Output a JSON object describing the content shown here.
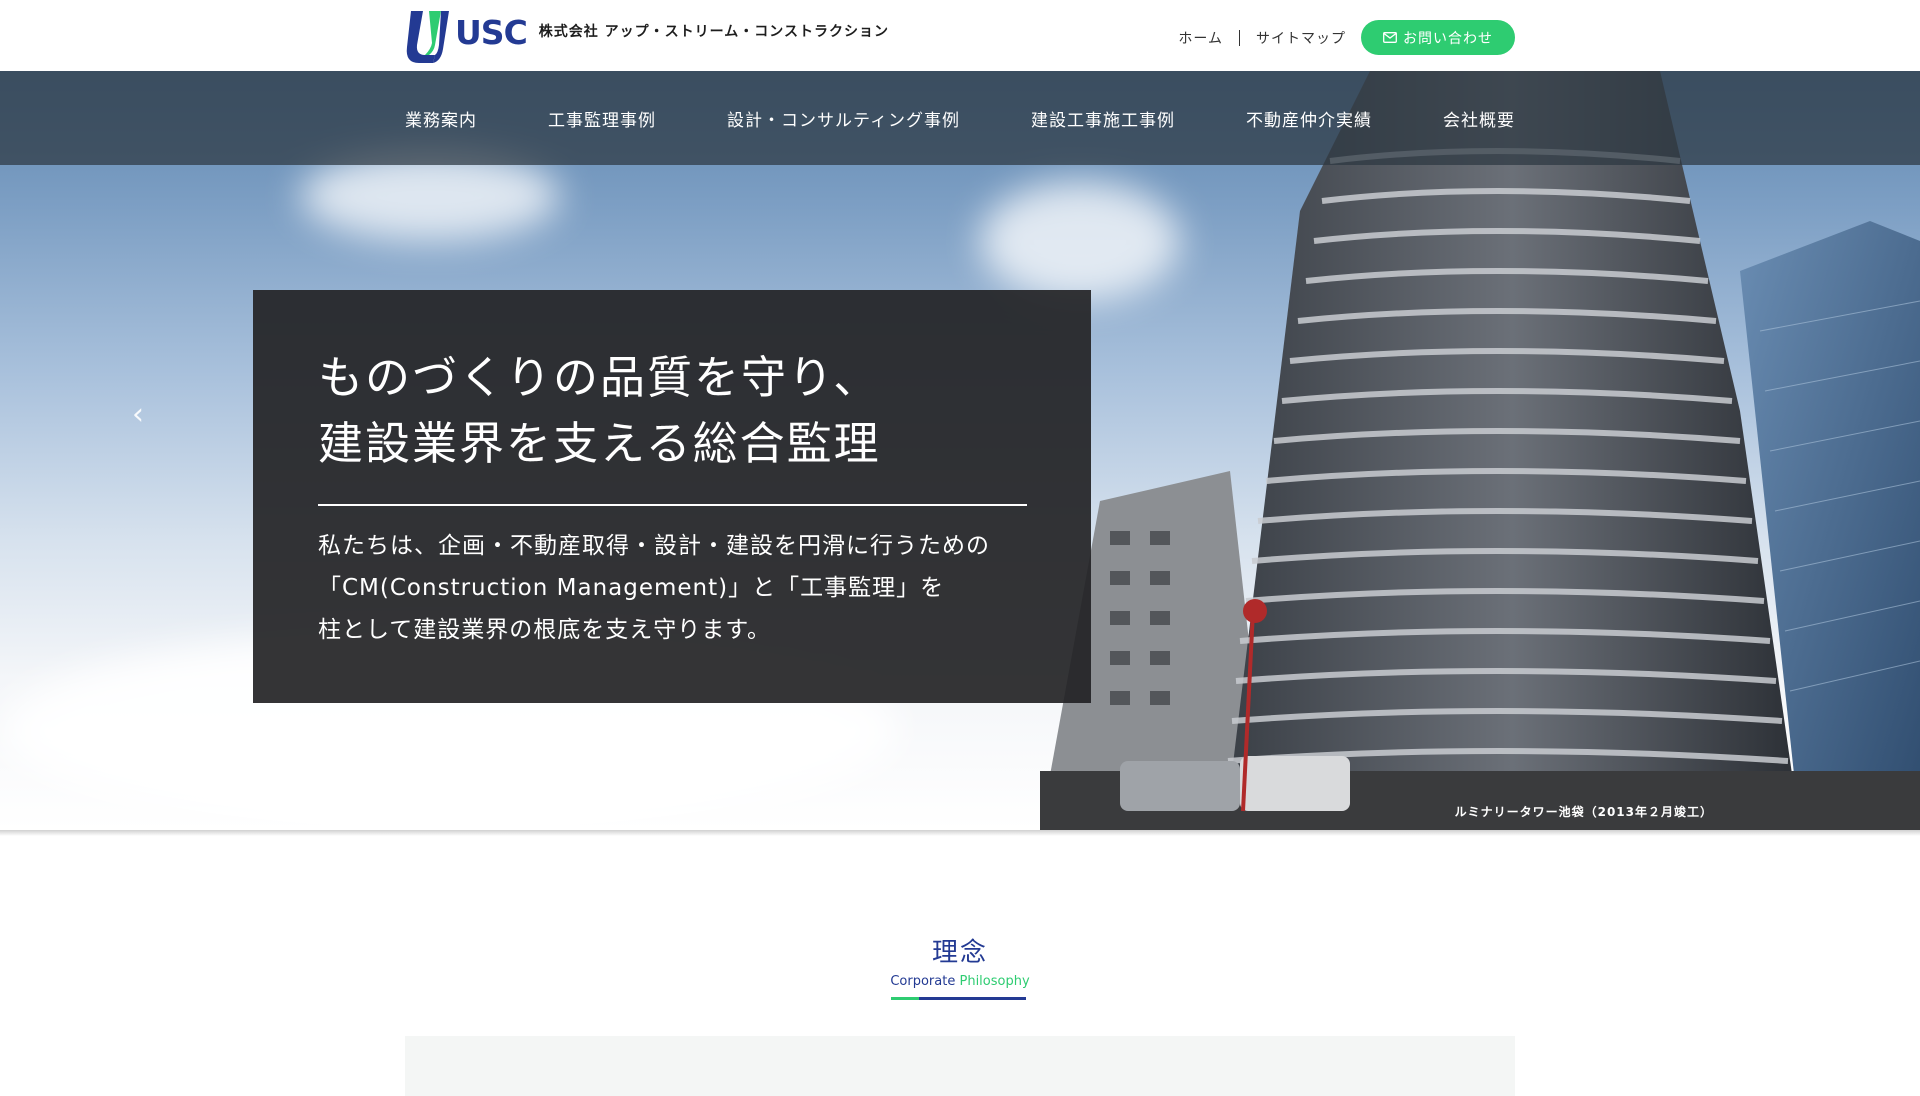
{
  "header": {
    "logo_text": "USC",
    "company_name": "株式会社 アップ・ストリーム・コンストラクション",
    "util_links": [
      "ホーム",
      "サイトマップ"
    ],
    "contact_label": "お問い合わせ"
  },
  "nav": {
    "items": [
      "業務案内",
      "工事監理事例",
      "設計・コンサルティング事例",
      "建設工事施工事例",
      "不動産仲介実績",
      "会社概要"
    ]
  },
  "hero": {
    "title_line1": "ものづくりの品質を守り、",
    "title_line2": "建設業界を支える総合監理",
    "desc_line1": "私たちは、企画・不動産取得・設計・建設を円滑に行うための",
    "desc_line2": "「CM(Construction Management)」と「工事監理」を",
    "desc_line3": "柱として建設業界の根底を支え守ります。",
    "caption": "ルミナリータワー池袋（2013年２月竣工）",
    "prev_icon": "chevron-left-icon"
  },
  "philosophy": {
    "title": "理念",
    "sub_primary": "Corporate",
    "sub_accent": "Philosophy"
  },
  "colors": {
    "brand_blue": "#233a93",
    "accent_green": "#2ecc71"
  }
}
